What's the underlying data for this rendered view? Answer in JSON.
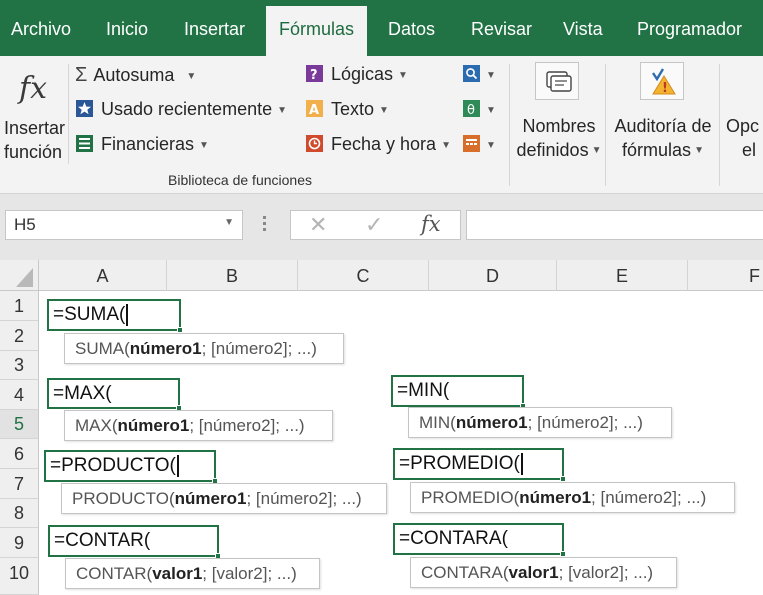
{
  "tabs": [
    "Archivo",
    "Inicio",
    "Insertar",
    "Fórmulas",
    "Datos",
    "Revisar",
    "Vista",
    "Programador"
  ],
  "active_tab": "Fórmulas",
  "ribbon": {
    "insert_function": [
      "Insertar",
      "función"
    ],
    "library": {
      "autosum": "Autosuma",
      "recent": "Usado recientemente",
      "financial": "Financieras",
      "logical": "Lógicas",
      "text": "Texto",
      "datetime": "Fecha y hora",
      "group_label": "Biblioteca de funciones"
    },
    "names": [
      "Nombres",
      "definidos"
    ],
    "audit": [
      "Auditoría de",
      "fórmulas"
    ],
    "options": [
      "Opc",
      "el"
    ],
    "colors": {
      "fx": "#3a3a3a",
      "logical": "#7a3a9a",
      "text": "#e8a33a",
      "datetime": "#d04a2c",
      "finance": "#217346",
      "recent": "#2b5797",
      "lookup": "#2b6cb0",
      "math": "#2e8b57",
      "more": "#d76f2a"
    }
  },
  "formula_bar": {
    "name_box": "H5",
    "cancel_icon": "✕",
    "enter_icon": "✓",
    "fx_icon": "fx",
    "formula": ""
  },
  "grid": {
    "columns": [
      "A",
      "B",
      "C",
      "D",
      "E",
      "F"
    ],
    "rows": [
      "1",
      "2",
      "3",
      "4",
      "5",
      "6",
      "7",
      "8",
      "9",
      "10"
    ],
    "selected_row": "5",
    "formulas": [
      {
        "text": "=SUMA(",
        "fn": "SUMA",
        "arg1": "número1",
        "rest": "; [número2]; ...)"
      },
      {
        "text": "=MAX(",
        "fn": "MAX",
        "arg1": "número1",
        "rest": "; [número2]; ...)"
      },
      {
        "text": "=MIN(",
        "fn": "MIN",
        "arg1": "número1",
        "rest": "; [número2]; ...)"
      },
      {
        "text": "=PRODUCTO(",
        "fn": "PRODUCTO",
        "arg1": "número1",
        "rest": "; [número2]; ...)"
      },
      {
        "text": "=PROMEDIO(",
        "fn": "PROMEDIO",
        "arg1": "número1",
        "rest": "; [número2]; ...)"
      },
      {
        "text": "=CONTAR(",
        "fn": "CONTAR",
        "arg1": "valor1",
        "rest": "; [valor2]; ...)"
      },
      {
        "text": "=CONTARA(",
        "fn": "CONTARA",
        "arg1": "valor1",
        "rest": "; [valor2]; ...)"
      }
    ]
  }
}
